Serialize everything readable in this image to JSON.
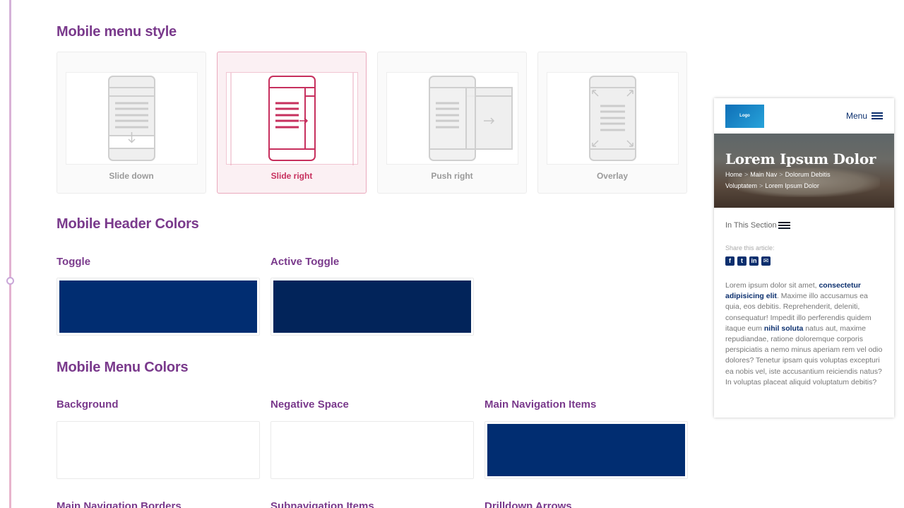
{
  "colors": {
    "heading": "#7a3a8c",
    "active_accent": "#c7305e",
    "toggle": "#012d71",
    "active_toggle": "#02245a",
    "white": "#ffffff",
    "nav_items": "#012d71"
  },
  "menu_style": {
    "title": "Mobile menu style",
    "options": [
      {
        "label": "Slide down",
        "icon": "slide-down-icon",
        "selected": false
      },
      {
        "label": "Slide right",
        "icon": "slide-right-icon",
        "selected": true
      },
      {
        "label": "Push right",
        "icon": "push-right-icon",
        "selected": false
      },
      {
        "label": "Overlay",
        "icon": "overlay-icon",
        "selected": false
      }
    ]
  },
  "header_colors": {
    "title": "Mobile Header Colors",
    "fields": [
      {
        "label": "Toggle",
        "color": "#012d71"
      },
      {
        "label": "Active Toggle",
        "color": "#02245a"
      }
    ]
  },
  "menu_colors": {
    "title": "Mobile Menu Colors",
    "fields": [
      {
        "label": "Background",
        "color": "#ffffff"
      },
      {
        "label": "Negative Space",
        "color": "#ffffff"
      },
      {
        "label": "Main Navigation Items",
        "color": "#012d71"
      },
      {
        "label": "Main Navigation Borders"
      },
      {
        "label": "Subnavigation Items"
      },
      {
        "label": "Drilldown Arrows"
      }
    ]
  },
  "preview": {
    "logo": "Logo",
    "menu": "Menu",
    "hero_title": "Lorem Ipsum Dolor",
    "breadcrumbs": [
      "Home",
      "Main Nav",
      "Dolorum Debitis Voluptatem",
      "Lorem Ipsum Dolor"
    ],
    "breadcrumb_sep": ">",
    "section_toggle": "In This Section",
    "share_label": "Share this article:",
    "share_icons": [
      "facebook-icon",
      "twitter-icon",
      "linkedin-icon",
      "email-icon"
    ],
    "body": {
      "t1": "Lorem ipsum dolor sit amet, ",
      "link1": "consectetur adipisicing elit",
      "t2": ". Maxime illo accusamus ea quia, eos debitis. Reprehenderit, deleniti, consequatur! Impedit illo perferendis quidem itaque eum ",
      "link2": "nihil soluta",
      "t3": " natus aut, maxime repudiandae, ratione doloremque corporis perspiciatis a nemo minus aperiam rem vel odio dolores? Tenetur ipsam quis voluptas excepturi ea nobis vel, iste accusantium reiciendis natus? In voluptas placeat aliquid voluptatum debitis?"
    }
  }
}
